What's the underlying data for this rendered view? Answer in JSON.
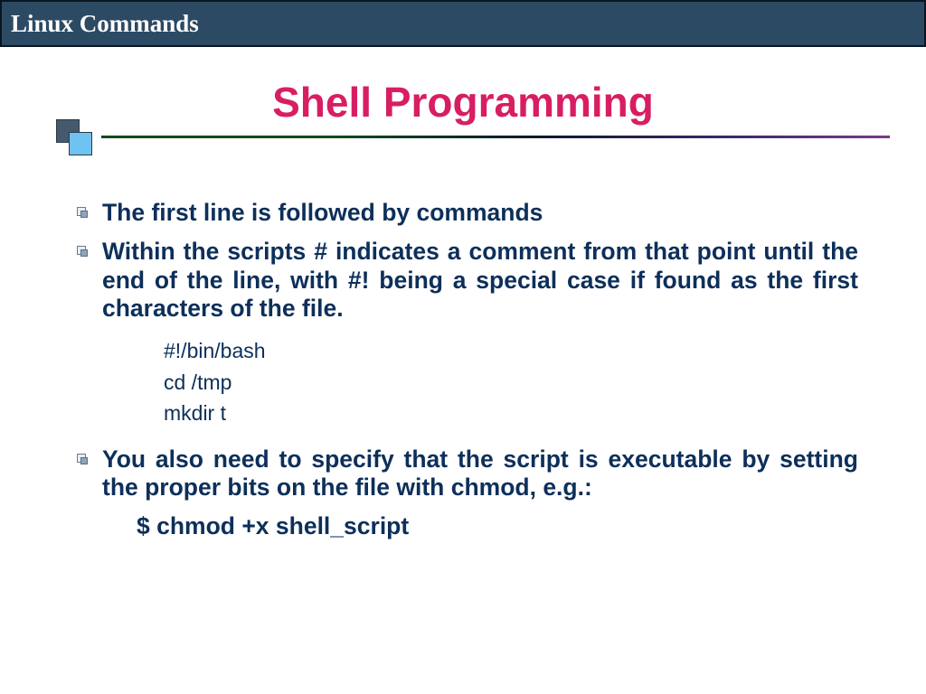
{
  "header": {
    "title": "Linux Commands"
  },
  "slide": {
    "title": "Shell Programming",
    "bullets": [
      "The first line is followed by commands",
      "Within the scripts # indicates a comment from that point until the end of the line, with #! being a special case if found as the first characters of the file.",
      "You also need to specify that the script is executable by setting the proper bits on the file with chmod, e.g.:"
    ],
    "code_lines": [
      "#!/bin/bash",
      "cd /tmp",
      "mkdir t"
    ],
    "chmod_line": "$ chmod +x shell_script"
  },
  "colors": {
    "header_bg": "#2c4a64",
    "title": "#d81e63",
    "body_text": "#0d2f5a"
  }
}
